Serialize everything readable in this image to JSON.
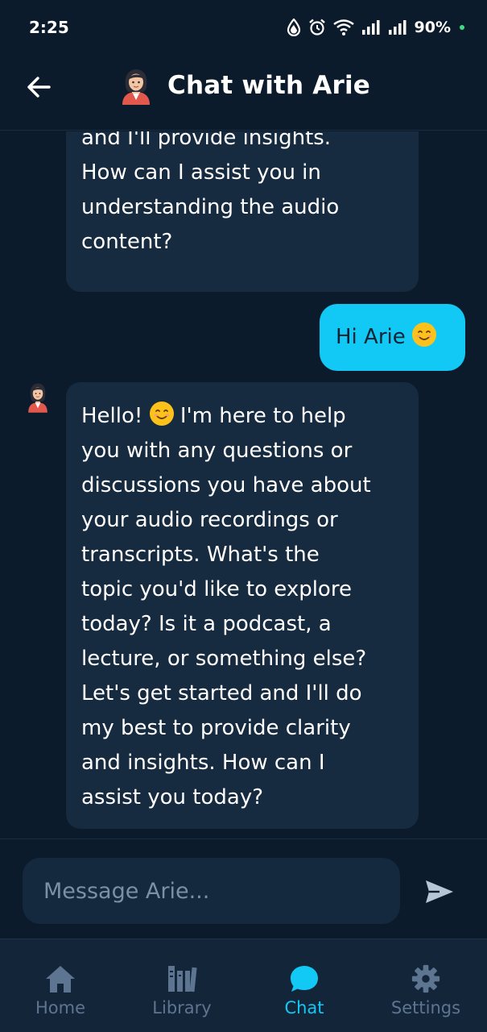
{
  "status_bar": {
    "time": "2:25",
    "battery": "90%",
    "icons": [
      "data-saver-icon",
      "alarm-icon",
      "wifi-icon",
      "signal-icon",
      "signal-icon",
      "battery-dot-icon"
    ]
  },
  "header": {
    "title": "Chat with Arie",
    "back_icon": "arrow-left-icon",
    "avatar_icon": "assistant-avatar-icon"
  },
  "messages": [
    {
      "role": "assistant",
      "text": "and I'll provide insights.\nHow can I assist you in\nunderstanding the audio\ncontent?"
    },
    {
      "role": "user",
      "text": "Hi Arie"
    },
    {
      "role": "assistant",
      "text_before_emoji": "Hello! ",
      "text_after_emoji": " I'm here to help\nyou with any questions or\ndiscussions you have about\nyour audio recordings or\ntranscripts. What's the\ntopic you'd like to explore\ntoday? Is it a podcast, a\nlecture, or something else?\nLet's get started and I'll do\nmy best to provide clarity\nand insights. How can I\nassist you today?"
    }
  ],
  "composer": {
    "placeholder": "Message Arie...",
    "send_icon": "send-icon"
  },
  "bottom_nav": {
    "items": [
      {
        "label": "Home",
        "icon": "home-icon",
        "active": false
      },
      {
        "label": "Library",
        "icon": "library-icon",
        "active": false
      },
      {
        "label": "Chat",
        "icon": "chat-bubble-icon",
        "active": true
      },
      {
        "label": "Settings",
        "icon": "gear-icon",
        "active": false
      }
    ]
  },
  "colors": {
    "background": "#0c1b2c",
    "assistant_bubble": "#162a40",
    "user_bubble": "#12c8f4",
    "accent": "#12c8f4",
    "nav_inactive": "#5d7590",
    "nav_background": "#132539"
  }
}
